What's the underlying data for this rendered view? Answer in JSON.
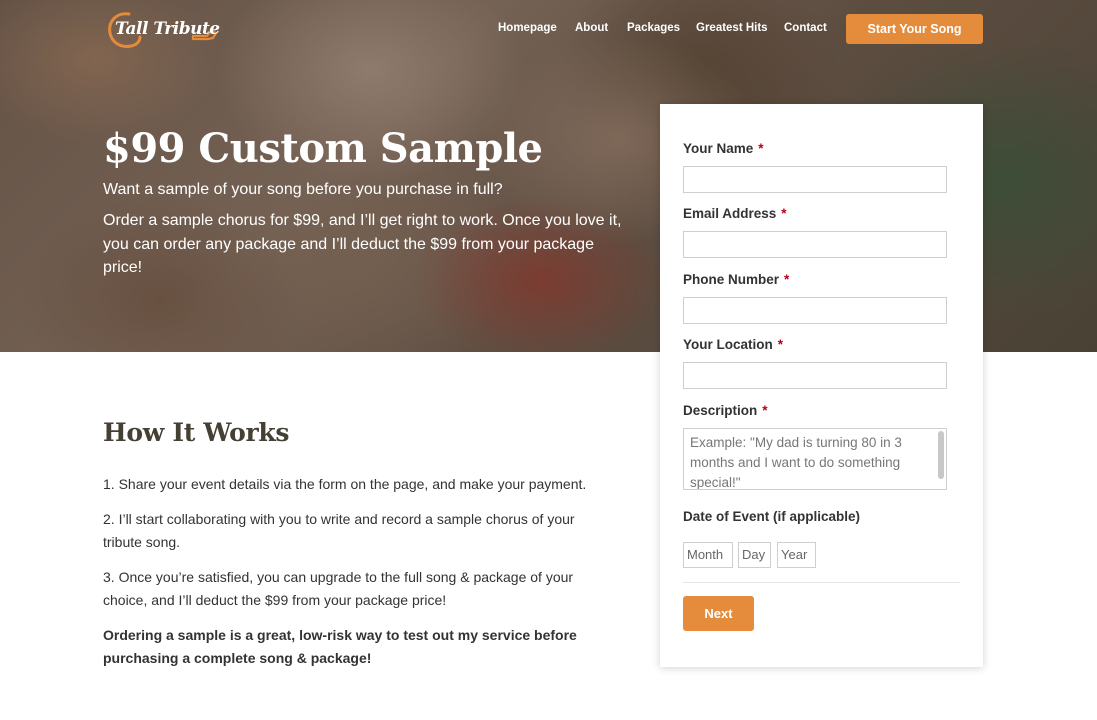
{
  "header": {
    "logo_text": "Tall Tribute",
    "nav": [
      "Homepage",
      "About",
      "Packages",
      "Greatest Hits",
      "Contact"
    ],
    "cta_label": "Start Your Song"
  },
  "hero": {
    "title": "$99 Custom Sample",
    "subtitle": "Want a sample of your song before you purchase in full?",
    "body": "Order a sample chorus for $99, and I’ll get right to work. Once you love it, you can order any package and I’ll deduct the $99 from your package price!"
  },
  "how": {
    "title": "How It Works",
    "steps": [
      "1. Share your event details via the form on the page, and make your payment.",
      "2. I’ll start collaborating with you to write and record a sample chorus of your tribute song.",
      "3. Once you’re satisfied, you can upgrade to the full song & package of your choice, and I’ll deduct the $99 from your package price!"
    ],
    "closing": "Ordering a sample is a great, low-risk way to test out my service before purchasing a complete song & package!"
  },
  "form": {
    "required_marker": "*",
    "name_label": "Your Name",
    "email_label": "Email Address",
    "phone_label": "Phone Number",
    "location_label": "Your Location",
    "description_label": "Description",
    "description_placeholder": "Example: \"My dad is turning 80 in 3 months and I want to do something special!\"",
    "date_label": "Date of Event (if applicable)",
    "date_month": "Month",
    "date_day": "Day",
    "date_year": "Year",
    "next_label": "Next"
  },
  "colors": {
    "accent": "#e58c3c",
    "required": "#b5001f"
  }
}
